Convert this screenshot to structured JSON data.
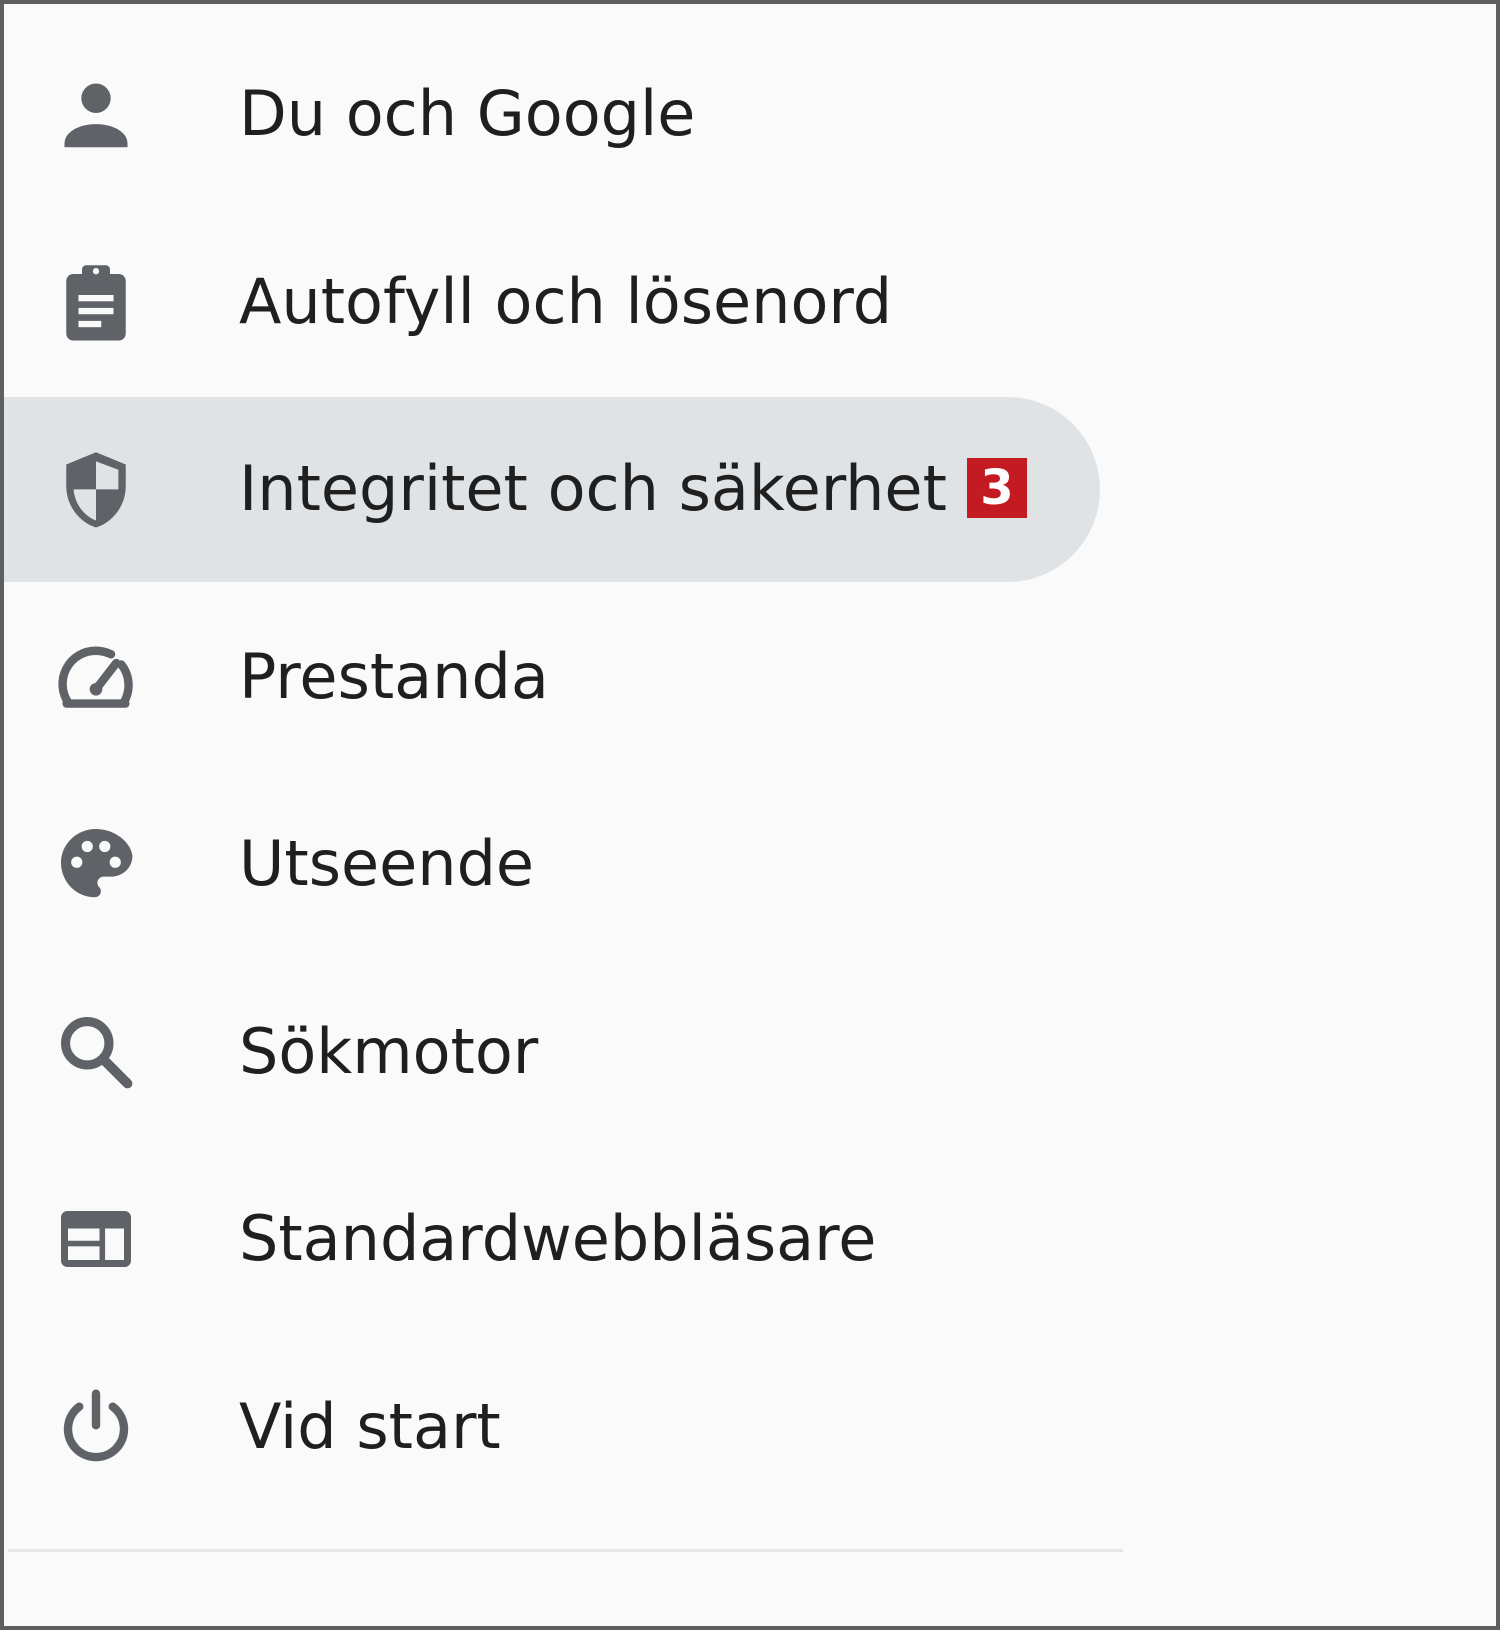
{
  "settings_menu": {
    "items": [
      {
        "label": "Du och Google",
        "icon": "person-icon"
      },
      {
        "label": "Autofyll och lösenord",
        "icon": "clipboard-icon"
      },
      {
        "label": "Integritet och säkerhet",
        "icon": "shield-icon",
        "selected": true,
        "badge": "3"
      },
      {
        "label": "Prestanda",
        "icon": "speedometer-icon"
      },
      {
        "label": "Utseende",
        "icon": "palette-icon"
      },
      {
        "label": "Sökmotor",
        "icon": "search-icon"
      },
      {
        "label": "Standardwebbläsare",
        "icon": "browser-window-icon"
      },
      {
        "label": "Vid start",
        "icon": "power-icon"
      }
    ]
  },
  "colors": {
    "icon": "#5f6368",
    "text": "#1f1f1f",
    "selected_background": "#e0e3e6",
    "badge_background": "#c41a22",
    "badge_text": "#ffffff"
  }
}
